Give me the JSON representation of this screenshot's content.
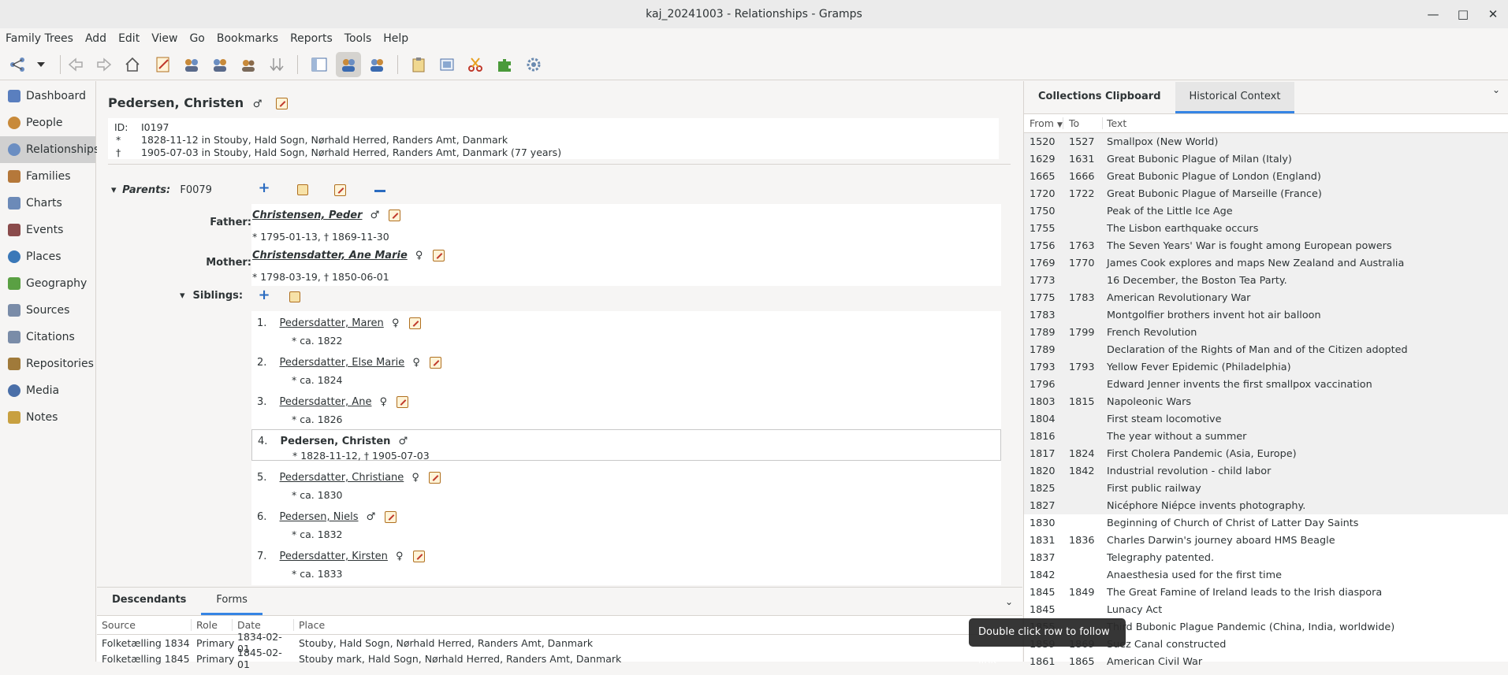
{
  "window": {
    "title": "kaj_20241003 - Relationships - Gramps"
  },
  "menu": [
    "Family Trees",
    "Add",
    "Edit",
    "View",
    "Go",
    "Bookmarks",
    "Reports",
    "Tools",
    "Help"
  ],
  "sidebar": {
    "items": [
      {
        "label": "Dashboard",
        "color": "#5a7fbf"
      },
      {
        "label": "People",
        "color": "#c88a3a"
      },
      {
        "label": "Relationships",
        "color": "#6b8ec2"
      },
      {
        "label": "Families",
        "color": "#b5783a"
      },
      {
        "label": "Charts",
        "color": "#6c8ab8"
      },
      {
        "label": "Events",
        "color": "#8a4b4b"
      },
      {
        "label": "Places",
        "color": "#3a78b8"
      },
      {
        "label": "Geography",
        "color": "#5aa043"
      },
      {
        "label": "Sources",
        "color": "#7a8ca8"
      },
      {
        "label": "Citations",
        "color": "#7a8ca8"
      },
      {
        "label": "Repositories",
        "color": "#a07a3a"
      },
      {
        "label": "Media",
        "color": "#4a6fa8"
      },
      {
        "label": "Notes",
        "color": "#c8a040"
      }
    ]
  },
  "person": {
    "name": "Pedersen, Christen",
    "gender": "♂",
    "id_label": "ID:",
    "id": "I0197",
    "birth_sym": "*",
    "birth": "1828-11-12 in Stouby, Hald Sogn, Nørhald Herred, Randers Amt, Danmark",
    "death_sym": "†",
    "death": "1905-07-03 in Stouby, Hald Sogn, Nørhald Herred, Randers Amt, Danmark (77 years)"
  },
  "parents": {
    "label": "Parents:",
    "family_id": "F0079",
    "father_label": "Father:",
    "father_name": "Christensen, Peder",
    "father_gender": "♂",
    "father_dates": "* 1795-01-13, † 1869-11-30",
    "mother_label": "Mother:",
    "mother_name": "Christensdatter, Ane Marie",
    "mother_gender": "♀",
    "mother_dates": "* 1798-03-19, † 1850-06-01"
  },
  "siblings": {
    "label": "Siblings:",
    "items": [
      {
        "num": "1.",
        "name": "Pedersdatter, Maren",
        "gender": "♀",
        "dates": "* ca. 1822"
      },
      {
        "num": "2.",
        "name": "Pedersdatter, Else Marie",
        "gender": "♀",
        "dates": "* ca. 1824"
      },
      {
        "num": "3.",
        "name": "Pedersdatter, Ane",
        "gender": "♀",
        "dates": "* ca. 1826"
      },
      {
        "num": "4.",
        "name": "Pedersen, Christen",
        "gender": "♂",
        "dates": "* 1828-11-12, † 1905-07-03"
      },
      {
        "num": "5.",
        "name": "Pedersdatter, Christiane",
        "gender": "♀",
        "dates": "* ca. 1830"
      },
      {
        "num": "6.",
        "name": "Pedersen, Niels",
        "gender": "♂",
        "dates": "* ca. 1832"
      },
      {
        "num": "7.",
        "name": "Pedersdatter, Kirsten",
        "gender": "♀",
        "dates": "* ca. 1833"
      }
    ]
  },
  "bottom": {
    "tabs": [
      "Descendants",
      "Forms"
    ],
    "headers": [
      "Source",
      "Role",
      "Date",
      "Place"
    ],
    "rows": [
      [
        "Folketælling 1834",
        "Primary",
        "1834-02-01",
        "Stouby, Hald Sogn, Nørhald Herred, Randers Amt, Danmark"
      ],
      [
        "Folketælling 1845",
        "Primary",
        "1845-02-01",
        "Stouby mark, Hald Sogn, Nørhald Herred, Randers Amt, Danmark"
      ]
    ]
  },
  "right": {
    "tabs": [
      "Collections Clipboard",
      "Historical Context"
    ],
    "headers": [
      "From",
      "To",
      "Text"
    ],
    "rows": [
      [
        "1520",
        "1527",
        "Smallpox (New World)"
      ],
      [
        "1629",
        "1631",
        "Great Bubonic Plague of Milan (Italy)"
      ],
      [
        "1665",
        "1666",
        "Great Bubonic Plague of London (England)"
      ],
      [
        "1720",
        "1722",
        "Great Bubonic Plague of Marseille (France)"
      ],
      [
        "1750",
        "",
        "Peak of the Little Ice Age"
      ],
      [
        "1755",
        "",
        "The Lisbon earthquake occurs"
      ],
      [
        "1756",
        "1763",
        "The Seven Years' War is fought among European powers"
      ],
      [
        "1769",
        "1770",
        "James Cook explores and maps New Zealand and Australia"
      ],
      [
        "1773",
        "",
        "16 December, the Boston Tea Party."
      ],
      [
        "1775",
        "1783",
        "American Revolutionary War"
      ],
      [
        "1783",
        "",
        "Montgolfier brothers invent hot air balloon"
      ],
      [
        "1789",
        "1799",
        "French Revolution"
      ],
      [
        "1789",
        "",
        "Declaration of the Rights of Man and of the Citizen adopted"
      ],
      [
        "1793",
        "1793",
        "Yellow Fever Epidemic (Philadelphia)"
      ],
      [
        "1796",
        "",
        "Edward Jenner invents the first smallpox vaccination"
      ],
      [
        "1803",
        "1815",
        "Napoleonic Wars"
      ],
      [
        "1804",
        "",
        "First steam locomotive"
      ],
      [
        "1816",
        "",
        "The year without a summer"
      ],
      [
        "1817",
        "1824",
        "First Cholera Pandemic (Asia, Europe)"
      ],
      [
        "1820",
        "1842",
        "Industrial revolution - child labor"
      ],
      [
        "1825",
        "",
        "First public railway"
      ],
      [
        "1827",
        "",
        "Nicéphore Niépce invents photography."
      ],
      [
        "1830",
        "",
        "Beginning of Church of Christ of Latter Day Saints"
      ],
      [
        "1831",
        "1836",
        "Charles Darwin's journey aboard HMS Beagle"
      ],
      [
        "1837",
        "",
        "Telegraphy patented."
      ],
      [
        "1842",
        "",
        "Anaesthesia used for the first time"
      ],
      [
        "1845",
        "1849",
        "The Great Famine of Ireland leads to the Irish diaspora"
      ],
      [
        "1845",
        "",
        "Lunacy Act"
      ],
      [
        "1855",
        "",
        "Third Bubonic Plague Pandemic (China, India, worldwide)"
      ],
      [
        "1859",
        "1869",
        "Suez Canal constructed"
      ],
      [
        "1861",
        "1865",
        "American Civil War"
      ]
    ]
  },
  "tooltip": "Double click row to follow link"
}
